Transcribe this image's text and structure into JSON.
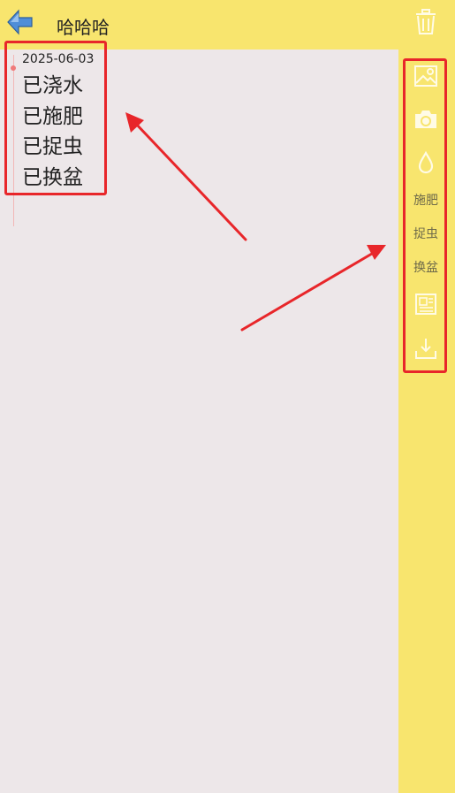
{
  "header": {
    "title": "哈哈哈",
    "back_icon": "back-arrow-icon",
    "trash_icon": "trash-icon"
  },
  "entry": {
    "date": "2025-06-03",
    "logs": [
      "已浇水",
      "已施肥",
      "已捉虫",
      "已换盆"
    ]
  },
  "sidebar": {
    "image_icon": "image-icon",
    "camera_icon": "camera-icon",
    "water_icon": "water-drop-icon",
    "fertilize_label": "施肥",
    "bug_label": "捉虫",
    "repot_label": "换盆",
    "note_icon": "note-icon",
    "export_icon": "export-icon"
  },
  "colors": {
    "header_bg": "#f8e56e",
    "content_bg": "#ede7e9",
    "annotation": "#e8262a"
  }
}
